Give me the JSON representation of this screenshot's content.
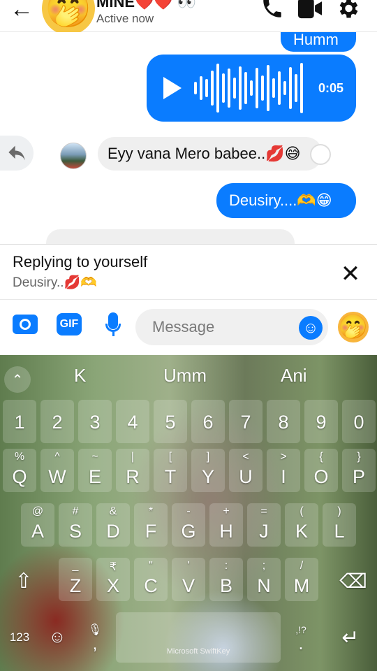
{
  "header": {
    "back_icon": "←",
    "contact_name": "MINE❤️❤️ 👀",
    "status": "Active now",
    "avatar_emoji": "🤭",
    "call_icon": "✆",
    "video_icon": "■",
    "settings_icon": "⚙"
  },
  "messages": {
    "humm": "Humm",
    "voice_duration": "0:05",
    "incoming_text": "Eyy vana Mero babee..💋😅",
    "deusiry": "Deusiry....🫶😁"
  },
  "reply_bar": {
    "title": "Replying to yourself",
    "quoted": "Deusiry..💋🫶",
    "close_icon": "✕"
  },
  "composer": {
    "gif_label": "GIF",
    "placeholder": "Message",
    "smile_icon": "☺",
    "emoji": "🤭"
  },
  "keyboard": {
    "suggestions": [
      "K",
      "Umm",
      "Ani"
    ],
    "number_row": [
      "1",
      "2",
      "3",
      "4",
      "5",
      "6",
      "7",
      "8",
      "9",
      "0"
    ],
    "row1": [
      {
        "main": "Q",
        "alt": "%"
      },
      {
        "main": "W",
        "alt": "^"
      },
      {
        "main": "E",
        "alt": "~"
      },
      {
        "main": "R",
        "alt": "|"
      },
      {
        "main": "T",
        "alt": "["
      },
      {
        "main": "Y",
        "alt": "]"
      },
      {
        "main": "U",
        "alt": "<"
      },
      {
        "main": "I",
        "alt": ">"
      },
      {
        "main": "O",
        "alt": "{"
      },
      {
        "main": "P",
        "alt": "}"
      }
    ],
    "row2": [
      {
        "main": "A",
        "alt": "@"
      },
      {
        "main": "S",
        "alt": "#"
      },
      {
        "main": "D",
        "alt": "&"
      },
      {
        "main": "F",
        "alt": "*"
      },
      {
        "main": "G",
        "alt": "-"
      },
      {
        "main": "H",
        "alt": "+"
      },
      {
        "main": "J",
        "alt": "="
      },
      {
        "main": "K",
        "alt": "("
      },
      {
        "main": "L",
        "alt": ")"
      }
    ],
    "row3": [
      {
        "main": "Z",
        "alt": "_"
      },
      {
        "main": "X",
        "alt": "₹"
      },
      {
        "main": "C",
        "alt": "\""
      },
      {
        "main": "V",
        "alt": "'"
      },
      {
        "main": "B",
        "alt": ":"
      },
      {
        "main": "N",
        "alt": ";"
      },
      {
        "main": "M",
        "alt": "/"
      }
    ],
    "shift_icon": "⇧",
    "backspace_icon": "⌫",
    "num_label": "123",
    "emoji_icon": "☺",
    "comma": ",",
    "space_label": "Microsoft SwiftKey",
    "period_alt": ",!?",
    "period": ".",
    "enter_icon": "↵"
  }
}
